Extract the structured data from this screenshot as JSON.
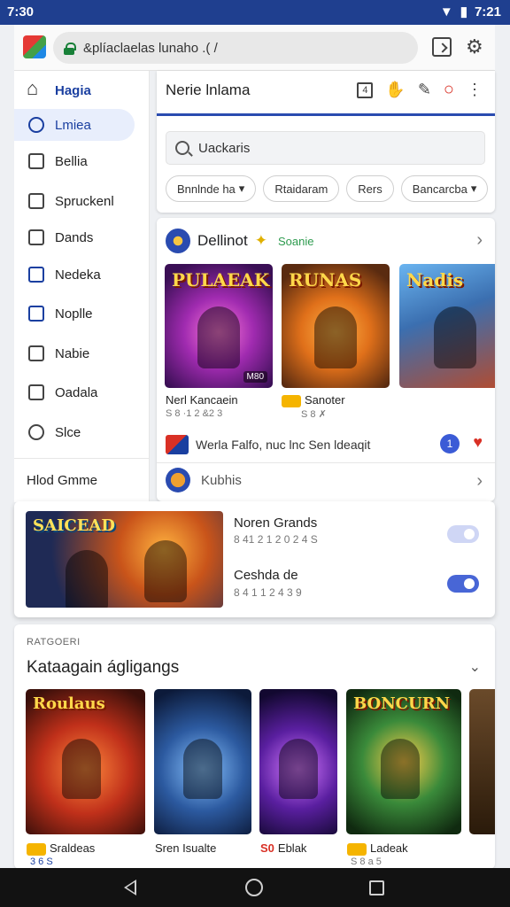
{
  "status": {
    "time": "7:30",
    "clock_right": "7:21"
  },
  "browser": {
    "url": "&plíaclaelas lunaho .( /"
  },
  "sidebar": {
    "items": [
      {
        "label": "Hagia"
      },
      {
        "label": "Lmiea"
      },
      {
        "label": "Bellia"
      },
      {
        "label": "Spruckenl"
      },
      {
        "label": "Dands"
      },
      {
        "label": "Nedeka"
      },
      {
        "label": "Noplle"
      },
      {
        "label": "Nabie"
      },
      {
        "label": "Oadala"
      },
      {
        "label": "Slce"
      }
    ],
    "footer": "Hlod Gmme"
  },
  "panel": {
    "title": "Nerie lnlama",
    "search_placeholder": "Uackaris",
    "chips": [
      {
        "label": "Bnnlnde ha",
        "dropdown": true
      },
      {
        "label": "Rtaidaram",
        "dropdown": false
      },
      {
        "label": "Rers",
        "dropdown": false
      },
      {
        "label": "Bancarcba",
        "dropdown": true
      }
    ]
  },
  "featured": {
    "title": "Dellinot",
    "tag": "Soanie",
    "games": [
      {
        "art": "PULAEAK",
        "name": "Nerl Kancaein",
        "meta": "S 8 ·1 2 &2 3",
        "badge": "M80"
      },
      {
        "art": "RUNAS",
        "name": "Sanoter",
        "meta": "S 8 ✗",
        "badge": ""
      },
      {
        "art": "Nadis",
        "name": "",
        "meta": "",
        "badge": ""
      }
    ],
    "promo": "Werla Falfo, nuc lnc Sen ldeaqit",
    "promo_count": "1",
    "sub_title": "Kubhis"
  },
  "banner": {
    "art": "SAICEAD",
    "items": [
      {
        "title": "Noren Grands",
        "sub": "8 41 2 1 2 0 2 4 S",
        "on": false
      },
      {
        "title": "Ceshda de",
        "sub": "8 4 1 1 2 4 3 9",
        "on": true
      }
    ]
  },
  "categories": {
    "eyebrow": "RATGOERI",
    "title": "Kataagain ágligangs",
    "tiles": [
      {
        "art": "Roulaus",
        "name": "Sraldeas",
        "sub": "3 6 S"
      },
      {
        "art": "",
        "name": "Sren Isualte",
        "sub": ""
      },
      {
        "art": "",
        "name": "Eblak",
        "sub": "",
        "prefix": "S0"
      },
      {
        "art": "BONCURN",
        "name": "Ladeak",
        "sub": "S 8 a 5"
      },
      {
        "art": "",
        "name": "",
        "sub": ""
      }
    ]
  },
  "colors": {
    "accent": "#2a4bb0",
    "statusbar": "#1f3f8f",
    "toggle_on": "#4866d6"
  }
}
